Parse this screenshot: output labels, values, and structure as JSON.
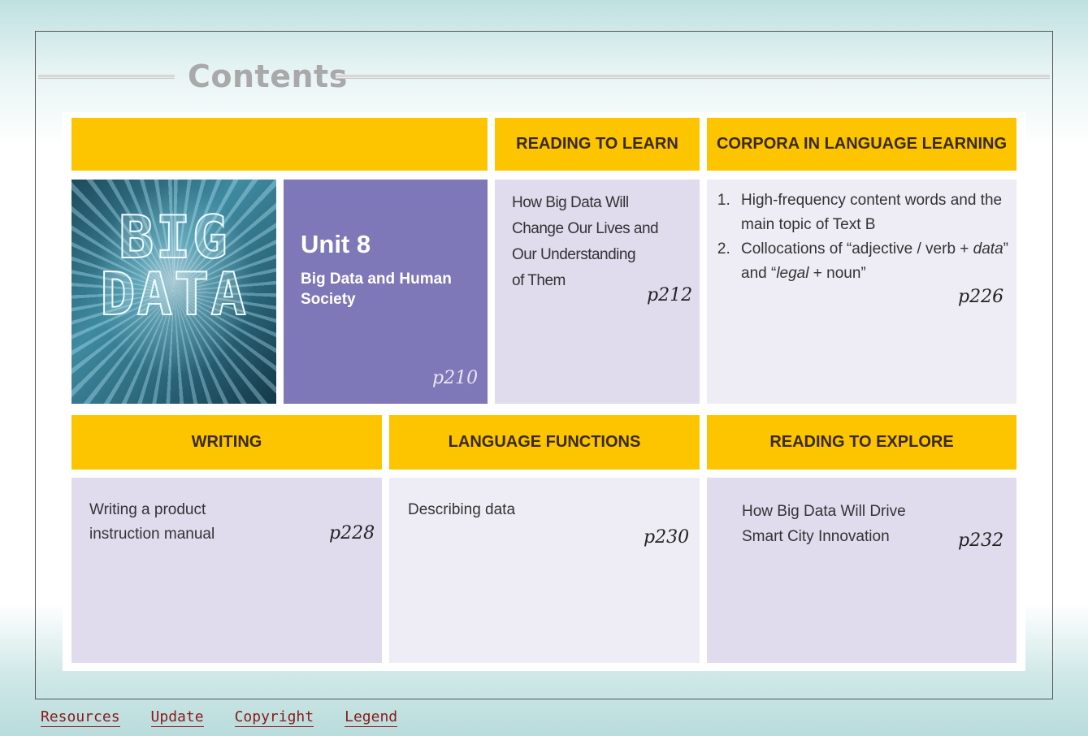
{
  "heading": "Contents",
  "image": {
    "text_lines": [
      "BIG",
      "DATA"
    ]
  },
  "unit": {
    "title": "Unit 8",
    "subtitle": "Big Data and Human Society",
    "page": "p210"
  },
  "top_sections": [
    {
      "header": "READING TO LEARN",
      "lines": [
        "How Big Data Will",
        "Change Our Lives and",
        "Our Understanding",
        "of Them"
      ],
      "page": "p212"
    },
    {
      "header": "CORPORA IN LANGUAGE LEARNING",
      "items": [
        {
          "text": "High-frequency content words and the main topic of Text B"
        },
        {
          "pre": "Collocations of “adjective / verb + ",
          "em1": "data",
          "mid": "” and “",
          "em2": "legal",
          "post": " + noun”"
        }
      ],
      "page": "p226"
    }
  ],
  "bottom_sections": [
    {
      "header": "WRITING",
      "lines": [
        "Writing a product",
        "instruction manual"
      ],
      "page": "p228"
    },
    {
      "header": "LANGUAGE FUNCTIONS",
      "lines": [
        "Describing data"
      ],
      "page": "p230"
    },
    {
      "header": "READING TO EXPLORE",
      "lines": [
        "How Big Data Will Drive",
        "Smart City Innovation"
      ],
      "page": "p232"
    }
  ],
  "footer": {
    "links": [
      "Resources",
      "Update",
      "Copyright",
      "Legend"
    ]
  },
  "colors": {
    "header_yellow": "#fcc500",
    "unit_purple": "#7f78b8",
    "cell_lavender": "#e0dcee",
    "link_color": "#8a1a1a"
  }
}
